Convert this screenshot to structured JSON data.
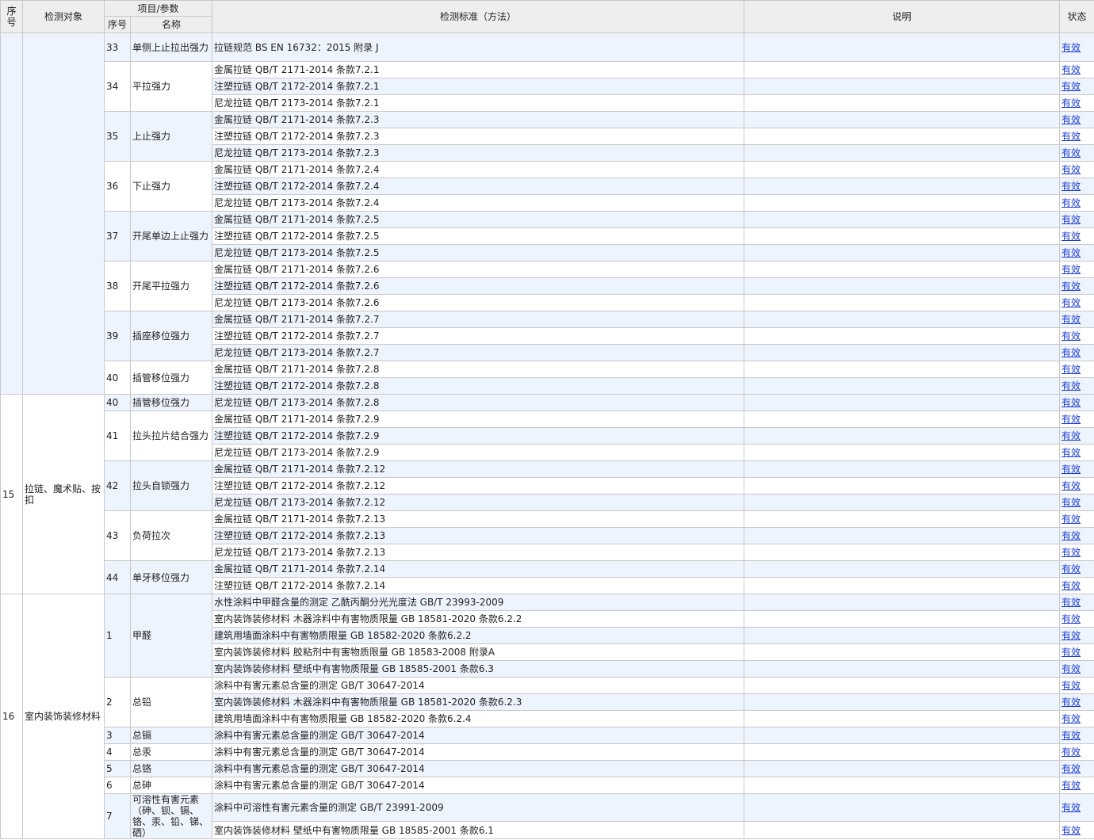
{
  "header": {
    "seq": "序号",
    "object": "检测对象",
    "project_param": "项目/参数",
    "sub_seq": "序号",
    "sub_name": "名称",
    "standard": "检测标准（方法）",
    "note": "说明",
    "status": "状态"
  },
  "groups": [
    {
      "seq": "",
      "object": "",
      "items": [
        {
          "no": "33",
          "name": "单侧上止拉出强力",
          "standards": [
            "拉链规范 BS EN 16732：2015 附录 J"
          ]
        },
        {
          "no": "34",
          "name": "平拉强力",
          "standards": [
            "金属拉链 QB/T 2171-2014 条款7.2.1",
            "注塑拉链 QB/T 2172-2014 条款7.2.1",
            "尼龙拉链 QB/T 2173-2014 条款7.2.1"
          ]
        },
        {
          "no": "35",
          "name": "上止强力",
          "standards": [
            "金属拉链 QB/T 2171-2014 条款7.2.3",
            "注塑拉链 QB/T 2172-2014 条款7.2.3",
            "尼龙拉链 QB/T 2173-2014 条款7.2.3"
          ]
        },
        {
          "no": "36",
          "name": "下止强力",
          "standards": [
            "金属拉链 QB/T 2171-2014 条款7.2.4",
            "注塑拉链 QB/T 2172-2014 条款7.2.4",
            "尼龙拉链 QB/T 2173-2014 条款7.2.4"
          ]
        },
        {
          "no": "37",
          "name": "开尾单边上止强力",
          "standards": [
            "金属拉链 QB/T 2171-2014 条款7.2.5",
            "注塑拉链 QB/T 2172-2014 条款7.2.5",
            "尼龙拉链 QB/T 2173-2014 条款7.2.5"
          ]
        },
        {
          "no": "38",
          "name": "开尾平拉强力",
          "standards": [
            "金属拉链 QB/T 2171-2014 条款7.2.6",
            "注塑拉链 QB/T 2172-2014 条款7.2.6",
            "尼龙拉链 QB/T 2173-2014 条款7.2.6"
          ]
        },
        {
          "no": "39",
          "name": "插座移位强力",
          "standards": [
            "金属拉链 QB/T 2171-2014 条款7.2.7",
            "注塑拉链 QB/T 2172-2014 条款7.2.7",
            "尼龙拉链 QB/T 2173-2014 条款7.2.7"
          ]
        },
        {
          "no": "40",
          "name": "插管移位强力",
          "standards": [
            "金属拉链 QB/T 2171-2014 条款7.2.8",
            "注塑拉链 QB/T 2172-2014 条款7.2.8"
          ]
        }
      ]
    },
    {
      "seq": "15",
      "object": "拉链、魔术贴、按扣",
      "items": [
        {
          "no": "40",
          "name": "插管移位强力",
          "standards": [
            "尼龙拉链 QB/T 2173-2014 条款7.2.8"
          ]
        },
        {
          "no": "41",
          "name": "拉头拉片结合强力",
          "standards": [
            "金属拉链 QB/T 2171-2014 条款7.2.9",
            "注塑拉链 QB/T 2172-2014 条款7.2.9",
            "尼龙拉链 QB/T 2173-2014 条款7.2.9"
          ]
        },
        {
          "no": "42",
          "name": "拉头自锁强力",
          "standards": [
            "金属拉链 QB/T 2171-2014 条款7.2.12",
            "注塑拉链 QB/T 2172-2014 条款7.2.12",
            "尼龙拉链 QB/T 2173-2014 条款7.2.12"
          ]
        },
        {
          "no": "43",
          "name": "负荷拉次",
          "standards": [
            "金属拉链 QB/T 2171-2014 条款7.2.13",
            "注塑拉链 QB/T 2172-2014 条款7.2.13",
            "尼龙拉链 QB/T 2173-2014 条款7.2.13"
          ]
        },
        {
          "no": "44",
          "name": "单牙移位强力",
          "standards": [
            "金属拉链 QB/T 2171-2014 条款7.2.14",
            "注塑拉链 QB/T 2172-2014 条款7.2.14"
          ]
        }
      ]
    },
    {
      "seq": "16",
      "object": "室内装饰装修材料",
      "items": [
        {
          "no": "1",
          "name": "甲醛",
          "standards": [
            "水性涂料中甲醛含量的测定 乙酰丙酮分光光度法 GB/T 23993-2009",
            "室内装饰装修材料 木器涂料中有害物质限量 GB 18581-2020 条款6.2.2",
            "建筑用墙面涂料中有害物质限量 GB 18582-2020 条款6.2.2",
            "室内装饰装修材料 胶粘剂中有害物质限量 GB 18583-2008 附录A",
            "室内装饰装修材料 壁纸中有害物质限量 GB 18585-2001 条款6.3"
          ]
        },
        {
          "no": "2",
          "name": "总铅",
          "standards": [
            "涂料中有害元素总含量的测定 GB/T 30647-2014",
            "室内装饰装修材料 木器涂料中有害物质限量 GB 18581-2020 条款6.2.3",
            "建筑用墙面涂料中有害物质限量 GB 18582-2020 条款6.2.4"
          ]
        },
        {
          "no": "3",
          "name": "总镉",
          "standards": [
            "涂料中有害元素总含量的测定 GB/T 30647-2014"
          ]
        },
        {
          "no": "4",
          "name": "总汞",
          "standards": [
            "涂料中有害元素总含量的测定 GB/T 30647-2014"
          ]
        },
        {
          "no": "5",
          "name": "总铬",
          "standards": [
            "涂料中有害元素总含量的测定 GB/T 30647-2014"
          ]
        },
        {
          "no": "6",
          "name": "总砷",
          "standards": [
            "涂料中有害元素总含量的测定 GB/T 30647-2014"
          ]
        },
        {
          "no": "7",
          "name": "可溶性有害元素（砷、钡、镉、铬、汞、铅、锑、硒）",
          "standards": [
            "涂料中可溶性有害元素含量的测定 GB/T 23991-2009",
            "室内装饰装修材料 壁纸中有害物质限量 GB 18585-2001 条款6.1"
          ]
        }
      ]
    }
  ],
  "status_label": "有效",
  "colors": {
    "header_bg": "#eeeeee",
    "row_alt": "#eef4fd",
    "link": "#1a3bd1",
    "border": "#c8c8c8"
  }
}
